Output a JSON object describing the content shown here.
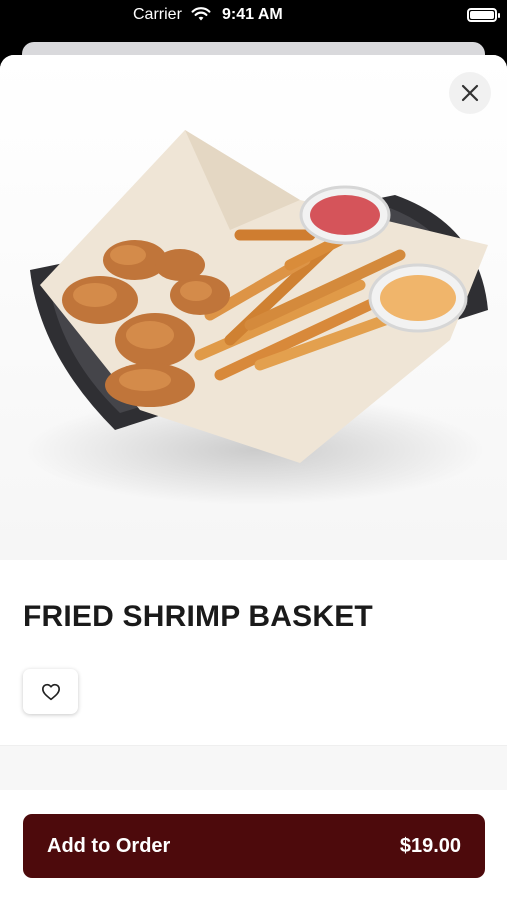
{
  "status_bar": {
    "carrier": "Carrier",
    "time": "9:41 AM"
  },
  "item": {
    "title": "FRIED SHRIMP BASKET"
  },
  "icons": {
    "close": "close-icon",
    "favorite": "heart-icon"
  },
  "footer": {
    "add_label": "Add to Order",
    "price": "$19.00"
  },
  "colors": {
    "accent": "#4d0a0c"
  }
}
